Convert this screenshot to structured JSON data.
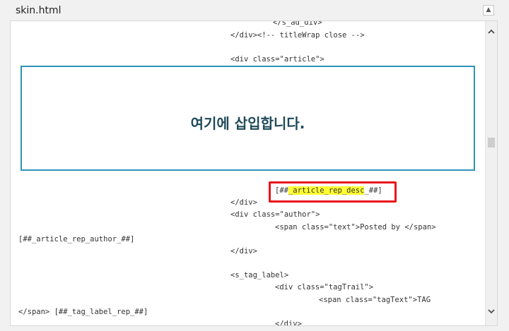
{
  "file_title": "skin.html",
  "collapse_icon": "▲",
  "scroll_up_icon": "chevron-up",
  "scroll_down_icon": "chevron-down",
  "insert_banner": "여기에 삽입합니다.",
  "code_lines": [
    "</s_ad_div>",
    "</div><!-- titleWrap close -->",
    "<div class=\"article\">",
    "</div>",
    "<div class=\"author\">",
    "<span class=\"text\">Posted by </span>",
    "[##_article_rep_author_##]",
    "</div>",
    "<s_tag_label>",
    "<div class=\"tagTrail\">",
    "<span class=\"tagText\">TAG",
    "</span> [##_tag_label_rep_##]",
    "</div>"
  ],
  "highlight_line": {
    "prefix": "[##",
    "highlighted": "_article_rep_desc",
    "suffix": "_##]"
  },
  "colors": {
    "insert_border": "#2e93b8",
    "highlight_border": "#e8141c",
    "highlight_fill": "#ffff33"
  }
}
